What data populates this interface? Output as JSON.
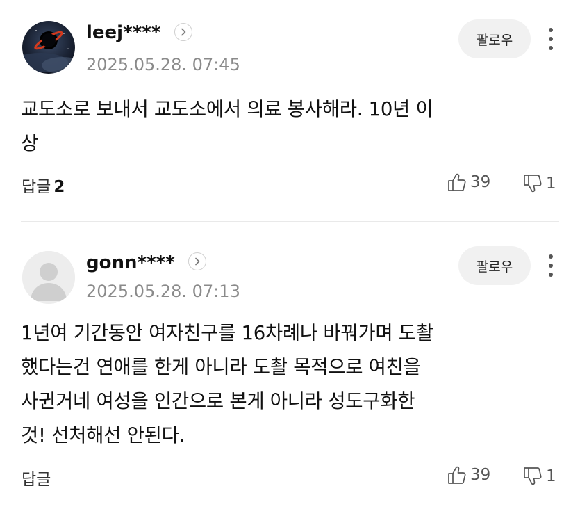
{
  "comments": [
    {
      "username": "leej****",
      "timestamp": "2025.05.28. 07:45",
      "follow_label": "팔로우",
      "text": "교도소로 보내서 교도소에서 의료 봉사해라. 10년 이\n상",
      "reply_label": "답글",
      "reply_count": "2",
      "likes": "39",
      "dislikes": "1",
      "avatar": "dark-space-image"
    },
    {
      "username": "gonn****",
      "timestamp": "2025.05.28. 07:13",
      "follow_label": "팔로우",
      "text": "1년여 기간동안 여자친구를 16차례나 바꿔가며 도촬\n했다는건 연애를 한게 아니라 도촬 목적으로 여친을\n사귄거네 여성을 인간으로 본게 아니라 성도구화한\n것! 선처해선 안된다.",
      "reply_label": "답글",
      "reply_count": "",
      "likes": "39",
      "dislikes": "1",
      "avatar": "default-person-icon"
    }
  ],
  "icons": {
    "profile_link": "chevron-right-icon",
    "more": "more-vertical-icon",
    "like": "thumbs-up-icon",
    "dislike": "thumbs-down-icon"
  },
  "colors": {
    "text": "#111111",
    "meta": "#8a8a8a",
    "button_bg": "#f1f1f1",
    "divider": "#e9e9e9"
  }
}
